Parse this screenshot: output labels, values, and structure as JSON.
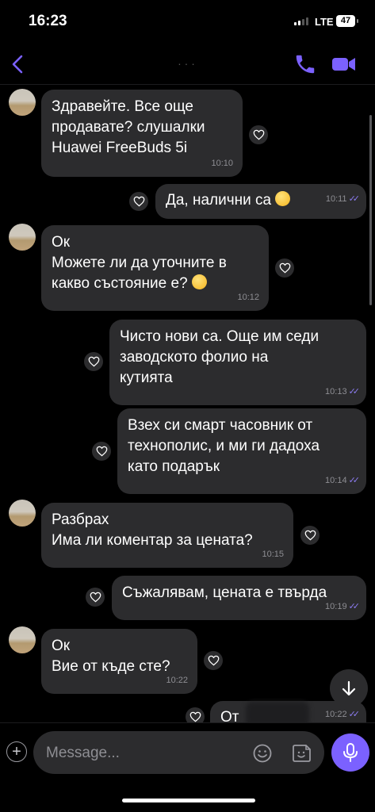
{
  "status_bar": {
    "time": "16:23",
    "network": "LTE",
    "battery": "47"
  },
  "header": {
    "title": "· · ·"
  },
  "messages": [
    {
      "id": 1,
      "direction": "in",
      "lines": [
        "Здравейте. Все още",
        "продавате? слушалки",
        "Huawei FreeBuds 5i"
      ],
      "time": "10:10"
    },
    {
      "id": 2,
      "direction": "out",
      "lines": [
        "Да, налични са"
      ],
      "time": "10:11"
    },
    {
      "id": 3,
      "direction": "in",
      "lines": [
        "Ок",
        "Можете ли да уточните в",
        "какво състояние е?"
      ],
      "time": "10:12"
    },
    {
      "id": 4,
      "direction": "out",
      "lines": [
        "Чисто нови са. Още им седи",
        "заводското фолио на",
        "кутията"
      ],
      "time": "10:13"
    },
    {
      "id": 5,
      "direction": "out",
      "lines": [
        "Взех си смарт часовник от",
        "технополис, и ми ги дадоха",
        "като подарък"
      ],
      "time": "10:14"
    },
    {
      "id": 6,
      "direction": "in",
      "lines": [
        "Разбрах",
        "Има ли коментар за цената?"
      ],
      "time": "10:15"
    },
    {
      "id": 7,
      "direction": "out",
      "lines": [
        "Съжалявам, цената е твърда"
      ],
      "time": "10:19"
    },
    {
      "id": 8,
      "direction": "in",
      "lines": [
        "Ок",
        "Вие от къде сте?"
      ],
      "time": "10:22"
    },
    {
      "id": 9,
      "direction": "out",
      "lines": [
        "От"
      ],
      "time": "10:22"
    }
  ],
  "composer": {
    "placeholder": "Message..."
  },
  "colors": {
    "accent": "#7b61ff",
    "bubble": "#2c2c2e",
    "background": "#000000",
    "timestamp": "#8e8e93"
  },
  "icons": [
    "back-chevron-icon",
    "phone-icon",
    "video-camera-icon",
    "heart-icon",
    "arrow-down-icon",
    "plus-icon",
    "smiley-icon",
    "sticker-icon",
    "microphone-icon"
  ]
}
